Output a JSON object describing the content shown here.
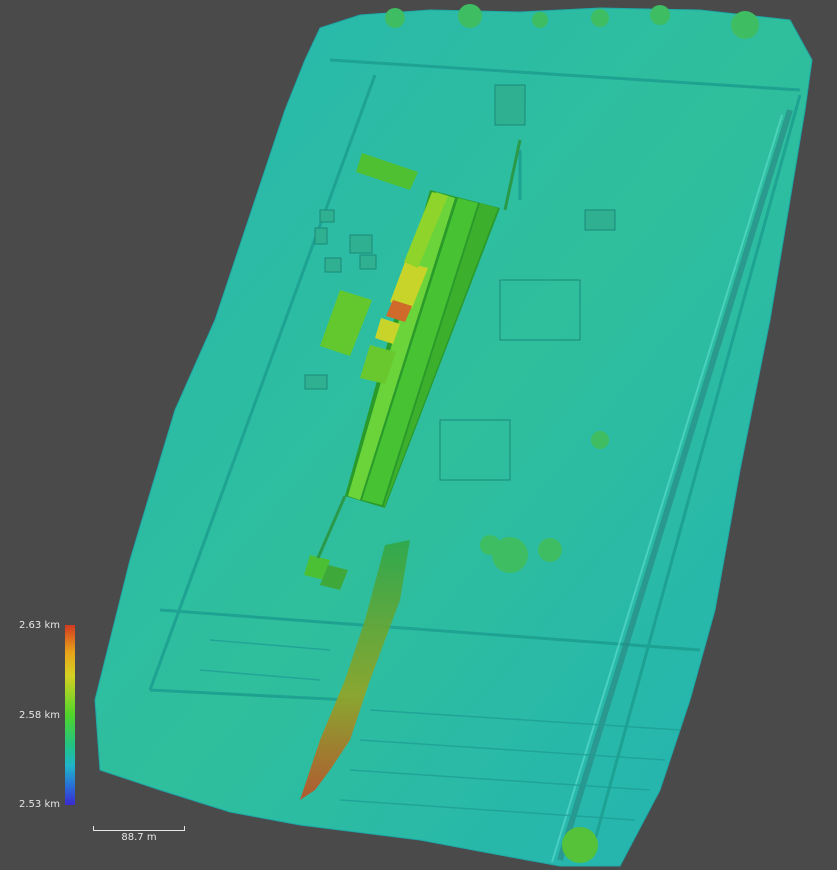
{
  "legend": {
    "max_label": "2.63 km",
    "mid_label": "2.58 km",
    "min_label": "2.53 km",
    "colors": [
      "#d13a22",
      "#e8a21a",
      "#d6d222",
      "#4fd42a",
      "#1fc28a",
      "#1fb6c8",
      "#2a6ad8",
      "#3a2ad0"
    ]
  },
  "scale": {
    "label": "88.7 m"
  },
  "colors": {
    "background": "#4a4a4a",
    "terrain_base": "#2cb8a8",
    "terrain_high": "#4fd42a",
    "peak": "#d13a22"
  }
}
